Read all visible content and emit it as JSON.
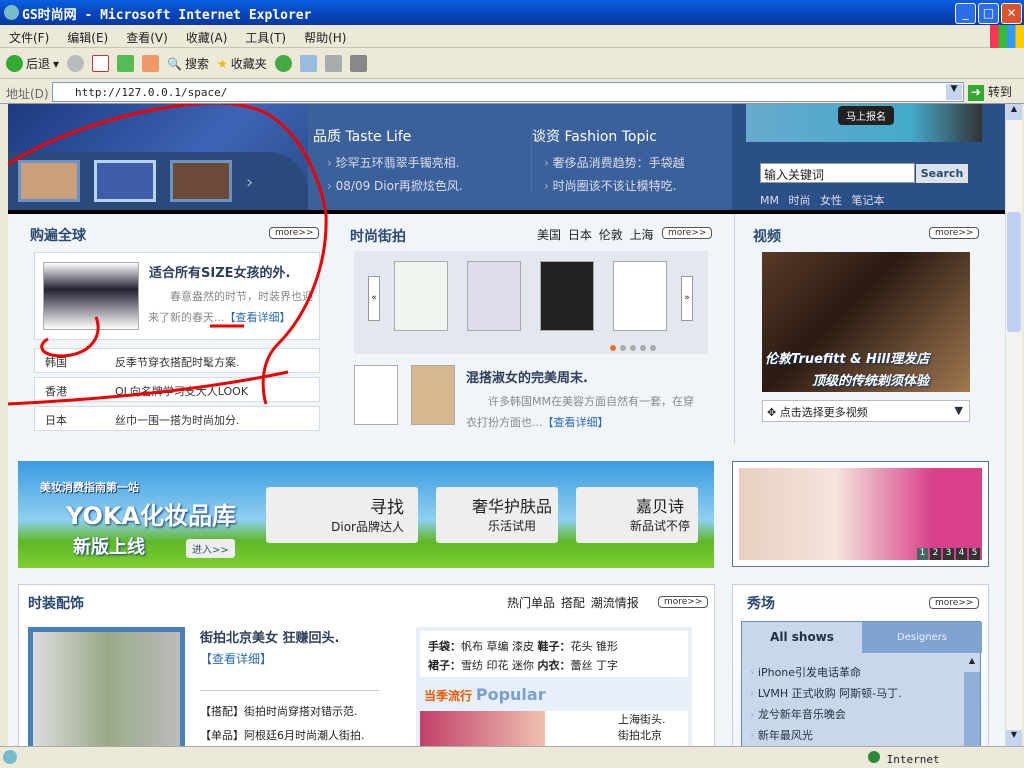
{
  "window": {
    "title": "GS时尚网 - Microsoft Internet Explorer",
    "minimize": "_",
    "maximize": "□",
    "close": "✕"
  },
  "menu": [
    "文件(F)",
    "编辑(E)",
    "查看(V)",
    "收藏(A)",
    "工具(T)",
    "帮助(H)"
  ],
  "toolbar": {
    "back": "后退",
    "search": "搜索",
    "favorites": "收藏夹"
  },
  "address": {
    "label": "地址(D)",
    "url": "http://127.0.0.1/space/",
    "go": "转到"
  },
  "hero": {
    "taste": {
      "title": "品质 Taste Life",
      "items": [
        "珍罕五环翡翠手镯亮相.",
        "08/09 Dior再掀炫色风."
      ]
    },
    "topic": {
      "title": "谈资 Fashion Topic",
      "items": [
        "奢侈品消费趋势：手袋越",
        "时尚圈该不该让模特吃."
      ]
    },
    "ad_button": "马上报名",
    "search": {
      "value": "输入关键词",
      "button": "Search",
      "tags": [
        "MM",
        "时尚",
        "女性",
        "笔记本"
      ]
    }
  },
  "more": "more>>",
  "shop": {
    "title": "购遍全球",
    "headline": "适合所有SIZE女孩的外.",
    "summary": "春意盎然的时节，时装界也迎来了新的春天...",
    "detail": "【查看详细】",
    "rows": [
      {
        "k": "韩国",
        "v": "反季节穿衣搭配时髦方案."
      },
      {
        "k": "香港",
        "v": "OL向名牌学习支大人LOOK"
      },
      {
        "k": "日本",
        "v": "丝巾一围一搭为时尚加分."
      }
    ]
  },
  "street": {
    "title": "时尚街拍",
    "tabs": [
      "美国",
      "日本",
      "伦敦",
      "上海"
    ],
    "prev": "«",
    "next": "»",
    "slides": 5,
    "active_slide": 1,
    "headline": "混搭淑女的完美周末.",
    "summary": "许多韩国MM在美容方面自然有一套，在穿衣打扮方面也...",
    "detail": "【查看详细】"
  },
  "video": {
    "title": "视频",
    "caption1": "伦敦Truefitt & Hill理发店",
    "caption2": "顶级的传统剃须体验",
    "select": "点击选择更多视频"
  },
  "banner": {
    "tagline": "美妆消费指南第一站",
    "brand": "YOKA化妆品库",
    "sub": "新版上线",
    "enter": "进入>>",
    "cards": [
      {
        "t": "寻找",
        "s": "Dior品牌达人"
      },
      {
        "t": "奢华护肤品",
        "s": "乐活试用"
      },
      {
        "t": "嘉贝诗",
        "s": "新品试不停"
      }
    ],
    "pages": [
      "1",
      "2",
      "3",
      "4",
      "5"
    ]
  },
  "accessory": {
    "title": "时装配饰",
    "tabs": [
      "热门单品",
      "搭配",
      "潮流情报"
    ],
    "headline": "街拍北京美女  狂赚回头.",
    "detail": "【查看详细】",
    "list": [
      "【搭配】街拍时尚穿搭对错示范.",
      "【单品】阿根廷6月时尚潮人街拍."
    ],
    "tags": [
      {
        "k": "手袋：",
        "v": "帆布 草编 漆皮"
      },
      {
        "k": "鞋子：",
        "v": "花头 锥形"
      },
      {
        "k": "裙子：",
        "v": "雪纺 印花 迷你"
      },
      {
        "k": "内衣：",
        "v": "蕾丝 丁字"
      }
    ],
    "popular_cn": "当季流行",
    "popular_en": "Popular",
    "popular_items": [
      "上海街头.",
      "街拍北京"
    ]
  },
  "show": {
    "title": "秀场",
    "tabs": [
      "All shows",
      "Designers"
    ],
    "items": [
      "iPhone引发电话革命",
      "LVMH 正式收购 阿斯顿-马丁.",
      "龙兮新年音乐晚会",
      "新年最风光"
    ]
  },
  "status": {
    "zone": "Internet"
  }
}
